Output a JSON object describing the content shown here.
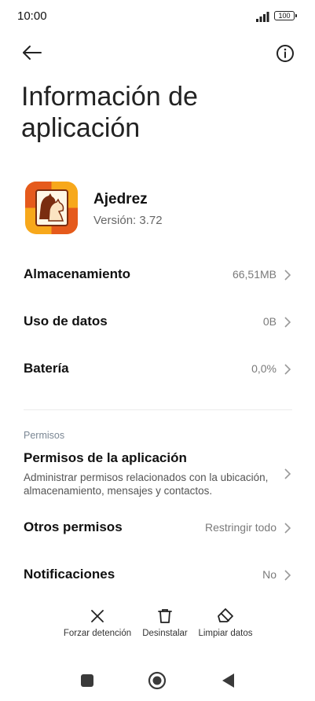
{
  "status_bar": {
    "time": "10:00",
    "battery": "100",
    "signal_icon": "signal-bars-icon"
  },
  "header": {
    "back_icon": "arrow-left-icon",
    "info_icon": "info-circle-icon",
    "title": "Información de aplicación"
  },
  "app": {
    "name": "Ajedrez",
    "version": "Versión: 3.72",
    "icon": "chess-knight-app-icon"
  },
  "rows": [
    {
      "label": "Almacenamiento",
      "value": "66,51MB"
    },
    {
      "label": "Uso de datos",
      "value": "0B"
    },
    {
      "label": "Batería",
      "value": "0,0%"
    }
  ],
  "permissions_section": {
    "label": "Permisos",
    "app_permissions_title": "Permisos de la aplicación",
    "app_permissions_desc": "Administrar permisos relacionados con la ubicación, almacenamiento, mensajes y contactos."
  },
  "other_rows": [
    {
      "label": "Otros permisos",
      "value": "Restringir todo"
    },
    {
      "label": "Notificaciones",
      "value": "No"
    }
  ],
  "actions": [
    {
      "label": "Forzar detención",
      "icon": "close-x-icon"
    },
    {
      "label": "Desinstalar",
      "icon": "trash-icon"
    },
    {
      "label": "Limpiar datos",
      "icon": "eraser-icon"
    }
  ],
  "nav": {
    "recents_icon": "square-recents-icon",
    "home_icon": "circle-home-icon",
    "back_icon": "triangle-back-icon"
  },
  "colors": {
    "accent_orange": "#f29b1d",
    "accent_red": "#d7432a"
  }
}
